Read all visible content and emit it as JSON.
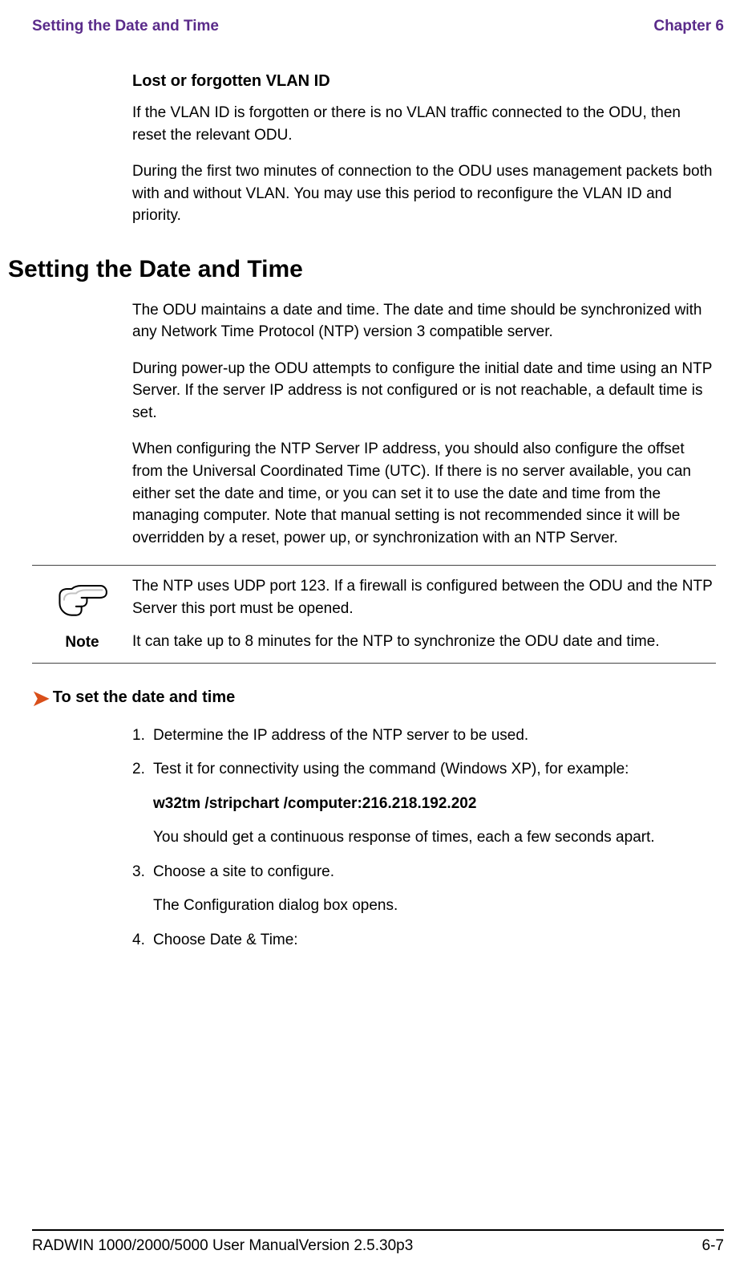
{
  "header": {
    "left": "Setting the Date and Time",
    "right": "Chapter 6"
  },
  "sections": {
    "lost_vlan": {
      "title": "Lost or forgotten VLAN ID",
      "p1": "If the VLAN ID is forgotten or there is no VLAN traffic connected to the ODU, then reset the relevant ODU.",
      "p2": "During the first two minutes of connection to the ODU uses management packets both with and without VLAN. You may use this period to reconfigure the VLAN ID and priority."
    },
    "datetime": {
      "title": "Setting the Date and Time",
      "p1": "The ODU maintains a date and time. The date and time should be synchronized with any Network Time Protocol (NTP) version 3 compatible server.",
      "p2": "During power-up the ODU attempts to configure the initial date and time using an NTP Server. If the server IP address is not configured or is not reachable, a default time is set.",
      "p3": "When configuring the NTP Server IP address, you should also configure the offset from the Universal Coordinated Time (UTC). If there is no server available, you can either set the date and time, or you can set it to use the date and time from the managing computer. Note that manual setting is not recommended since it will be overridden by a reset, power up, or synchronization with an NTP Server."
    }
  },
  "note": {
    "label": "Note",
    "p1": "The NTP uses UDP port 123. If a firewall is configured between the ODU and the NTP Server this port must be opened.",
    "p2": "It can take up to 8 minutes for the NTP to synchronize the ODU date and time."
  },
  "procedure": {
    "title": "To set the date and time",
    "steps": {
      "s1_num": "1.",
      "s1": "Determine the IP address of the NTP server to be used.",
      "s2_num": "2.",
      "s2": " Test it for connectivity using the command (Windows XP), for example:",
      "s2_cmd": "w32tm /stripchart /computer:216.218.192.202",
      "s2_res": "You should get a continuous response of times, each a few seconds apart.",
      "s3_num": "3.",
      "s3": "Choose a site to configure.",
      "s3_res": "The Configuration dialog box opens.",
      "s4_num": "4.",
      "s4": "Choose Date & Time:"
    }
  },
  "footer": {
    "left": "RADWIN 1000/2000/5000 User ManualVersion  2.5.30p3",
    "right": "6-7"
  }
}
